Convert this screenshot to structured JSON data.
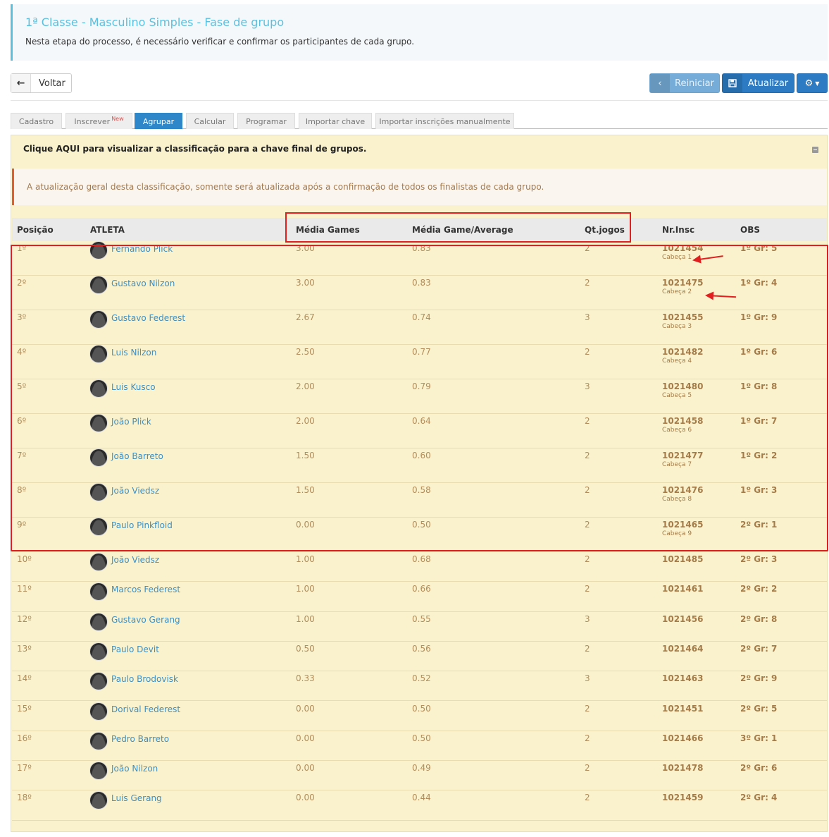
{
  "header": {
    "title": "1ª Classe - Masculino Simples - Fase de grupo",
    "description": "Nesta etapa do processo, é necessário verificar e confirmar os participantes de cada grupo."
  },
  "toolbar": {
    "back_label": "Voltar",
    "reset_label": "Reiniciar",
    "update_label": "Atualizar"
  },
  "tabs": [
    {
      "label": "Cadastro"
    },
    {
      "label": "Inscrever",
      "badge": "New"
    },
    {
      "label": "Agrupar"
    },
    {
      "label": "Calcular"
    },
    {
      "label": "Programar"
    },
    {
      "label": "Importar chave"
    },
    {
      "label": "Importar inscrições manualmente"
    }
  ],
  "panel": {
    "heading": "Clique AQUI para visualizar a classificação para a chave final de grupos.",
    "alert": "A atualização geral desta classificação, somente será atualizada após a confirmação de todos os finalistas de cada grupo."
  },
  "table": {
    "headers": {
      "position": "Posição",
      "athlete": "ATLETA",
      "avg_games": "Média Games",
      "avg_game_average": "Média Game/Average",
      "qt_games": "Qt.jogos",
      "nr_insc": "Nr.Insc",
      "obs": "OBS"
    },
    "rows": [
      {
        "pos": "1º",
        "name": "Fernando Plick",
        "avg": "3.00",
        "average": "0.83",
        "qt": "2",
        "nr": "1021454",
        "seed": "Cabeça 1",
        "obs": "1º Gr: 5"
      },
      {
        "pos": "2º",
        "name": "Gustavo Nilzon",
        "avg": "3.00",
        "average": "0.83",
        "qt": "2",
        "nr": "1021475",
        "seed": "Cabeça 2",
        "obs": "1º Gr: 4"
      },
      {
        "pos": "3º",
        "name": "Gustavo Federest",
        "avg": "2.67",
        "average": "0.74",
        "qt": "3",
        "nr": "1021455",
        "seed": "Cabeça 3",
        "obs": "1º Gr: 9"
      },
      {
        "pos": "4º",
        "name": "Luis Nilzon",
        "avg": "2.50",
        "average": "0.77",
        "qt": "2",
        "nr": "1021482",
        "seed": "Cabeça 4",
        "obs": "1º Gr: 6"
      },
      {
        "pos": "5º",
        "name": "Luis Kusco",
        "avg": "2.00",
        "average": "0.79",
        "qt": "3",
        "nr": "1021480",
        "seed": "Cabeça 5",
        "obs": "1º Gr: 8"
      },
      {
        "pos": "6º",
        "name": "João Plick",
        "avg": "2.00",
        "average": "0.64",
        "qt": "2",
        "nr": "1021458",
        "seed": "Cabeça 6",
        "obs": "1º Gr: 7"
      },
      {
        "pos": "7º",
        "name": "João Barreto",
        "avg": "1.50",
        "average": "0.60",
        "qt": "2",
        "nr": "1021477",
        "seed": "Cabeça 7",
        "obs": "1º Gr: 2"
      },
      {
        "pos": "8º",
        "name": "João Viedsz",
        "avg": "1.50",
        "average": "0.58",
        "qt": "2",
        "nr": "1021476",
        "seed": "Cabeça 8",
        "obs": "1º Gr: 3"
      },
      {
        "pos": "9º",
        "name": "Paulo Pinkfloid",
        "avg": "0.00",
        "average": "0.50",
        "qt": "2",
        "nr": "1021465",
        "seed": "Cabeça 9",
        "obs": "2º Gr: 1"
      },
      {
        "pos": "10º",
        "name": "João Viedsz",
        "avg": "1.00",
        "average": "0.68",
        "qt": "2",
        "nr": "1021485",
        "seed": "",
        "obs": "2º Gr: 3"
      },
      {
        "pos": "11º",
        "name": "Marcos Federest",
        "avg": "1.00",
        "average": "0.66",
        "qt": "2",
        "nr": "1021461",
        "seed": "",
        "obs": "2º Gr: 2"
      },
      {
        "pos": "12º",
        "name": "Gustavo Gerang",
        "avg": "1.00",
        "average": "0.55",
        "qt": "3",
        "nr": "1021456",
        "seed": "",
        "obs": "2º Gr: 8"
      },
      {
        "pos": "13º",
        "name": "Paulo Devit",
        "avg": "0.50",
        "average": "0.56",
        "qt": "2",
        "nr": "1021464",
        "seed": "",
        "obs": "2º Gr: 7"
      },
      {
        "pos": "14º",
        "name": "Paulo Brodovisk",
        "avg": "0.33",
        "average": "0.52",
        "qt": "3",
        "nr": "1021463",
        "seed": "",
        "obs": "2º Gr: 9"
      },
      {
        "pos": "15º",
        "name": "Dorival Federest",
        "avg": "0.00",
        "average": "0.50",
        "qt": "2",
        "nr": "1021451",
        "seed": "",
        "obs": "2º Gr: 5"
      },
      {
        "pos": "16º",
        "name": "Pedro Barreto",
        "avg": "0.00",
        "average": "0.50",
        "qt": "2",
        "nr": "1021466",
        "seed": "",
        "obs": "3º Gr: 1"
      },
      {
        "pos": "17º",
        "name": "João Nilzon",
        "avg": "0.00",
        "average": "0.49",
        "qt": "2",
        "nr": "1021478",
        "seed": "",
        "obs": "2º Gr: 6"
      },
      {
        "pos": "18º",
        "name": "Luis Gerang",
        "avg": "0.00",
        "average": "0.44",
        "qt": "2",
        "nr": "1021459",
        "seed": "",
        "obs": "2º Gr: 4"
      }
    ]
  },
  "colors": {
    "accent": "#2d7bc3",
    "highlight": "#e02020",
    "panel_bg": "#faf2cc"
  }
}
